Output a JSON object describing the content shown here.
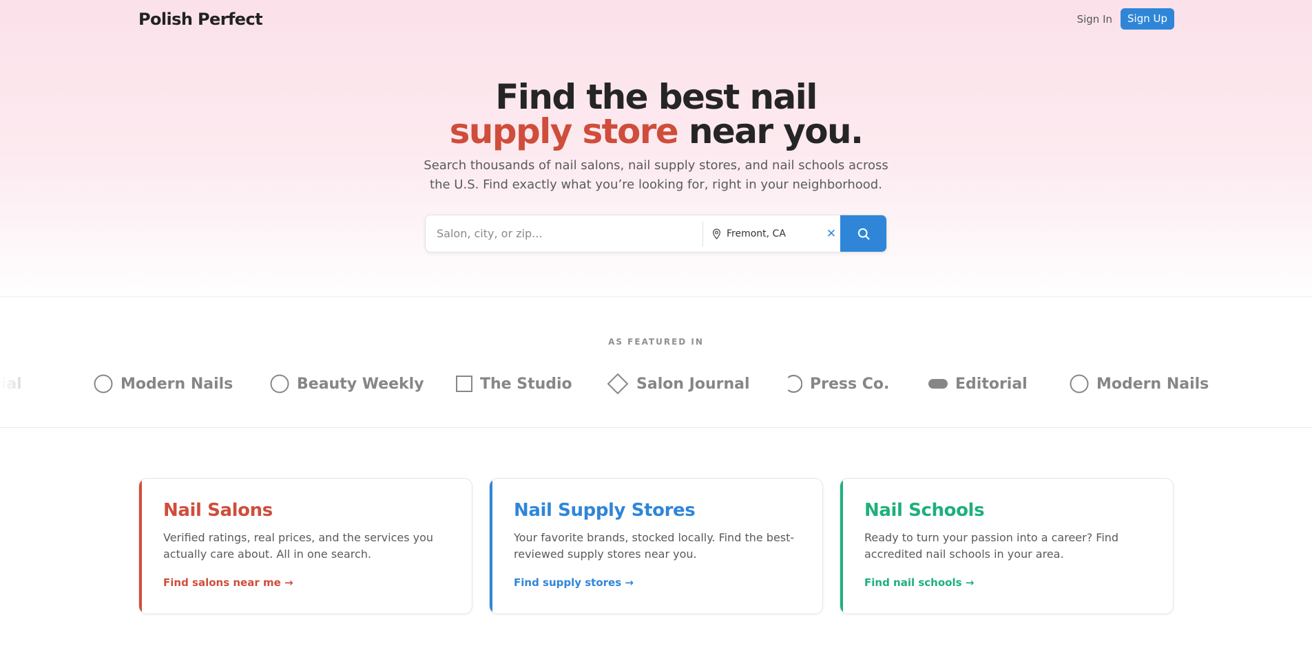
{
  "header": {
    "brand": "Polish Perfect",
    "sign_in": "Sign In",
    "sign_up": "Sign Up"
  },
  "hero": {
    "headline_line1": "Find the best nail",
    "headline_accent": "supply store",
    "headline_rest": " near you.",
    "subtitle": "Search thousands of nail salons, nail supply stores, and nail schools across the U.S. Find exactly what you’re looking for, right in your neighborhood."
  },
  "search": {
    "placeholder": "Salon, city, or zip...",
    "location_value": "Fremont, CA",
    "clear_symbol": "✕"
  },
  "featured": {
    "label": "AS FEATURED IN",
    "logos": [
      "Editorial",
      "Modern Nails",
      "Beauty Weekly",
      "The Studio",
      "Salon Journal",
      "Press Co.",
      "Editorial",
      "Modern Nails"
    ],
    "logo_icons": [
      "pill-icon",
      "circle-icon",
      "circle-icon",
      "square-icon",
      "diamond-icon",
      "arc-icon",
      "pill-icon",
      "circle-icon"
    ]
  },
  "cards": [
    {
      "title": "Nail Salons",
      "description": "Verified ratings, real prices, and the services you actually care about. All in one search.",
      "link": "Find salons near me →",
      "color": "#cf4d3b"
    },
    {
      "title": "Nail Supply Stores",
      "description": "Your favorite brands, stocked locally. Find the best-reviewed supply stores near you.",
      "link": "Find supply stores →",
      "color": "#2f86d8"
    },
    {
      "title": "Nail Schools",
      "description": "Ready to turn your passion into a career? Find accredited nail schools in your area.",
      "link": "Find nail schools →",
      "color": "#1db07a"
    }
  ],
  "colors": {
    "accent_red": "#cf4d3b",
    "accent_blue": "#2f86d8",
    "accent_green": "#1db07a",
    "logo_gray": "#868686"
  }
}
